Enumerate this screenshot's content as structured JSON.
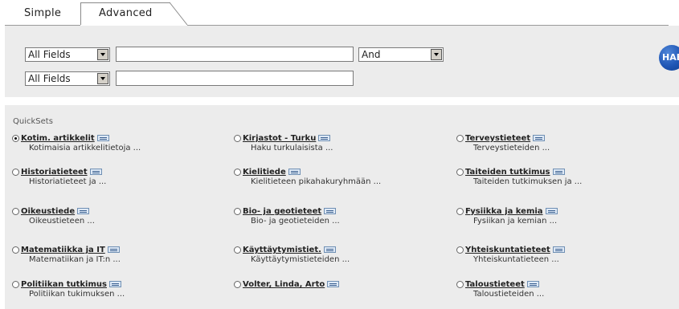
{
  "tabs": {
    "simple": "Simple",
    "advanced": "Advanced"
  },
  "search": {
    "row1": {
      "field": "All Fields",
      "value": "",
      "operator": "And"
    },
    "row2": {
      "field": "All Fields",
      "value": ""
    },
    "hab_label": "HAB"
  },
  "quicksets": {
    "title": "QuickSets",
    "items": [
      {
        "name": "Kotim. artikkelit",
        "desc": "Kotimaisia artikkelitietoja ...",
        "checked": true
      },
      {
        "name": "Kirjastot - Turku",
        "desc": "Haku turkulaisista ...",
        "checked": false
      },
      {
        "name": "Terveystieteet",
        "desc": "Terveystieteiden ...",
        "checked": false
      },
      {
        "name": "Historiatieteet",
        "desc": "Historiatieteet ja ...",
        "checked": false
      },
      {
        "name": "Kielitiede",
        "desc": "Kielitieteen pikahakuryhmään ...",
        "checked": false
      },
      {
        "name": "Taiteiden tutkimus",
        "desc": "Taiteiden tutkimuksen ja ...",
        "checked": false
      },
      {
        "name": "Oikeustiede",
        "desc": "Oikeustieteen ...",
        "checked": false
      },
      {
        "name": "Bio- ja geotieteet",
        "desc": "Bio- ja geotieteiden ...",
        "checked": false
      },
      {
        "name": "Fysiikka ja kemia",
        "desc": "Fysiikan ja kemian ...",
        "checked": false
      },
      {
        "name": "Matematiikka ja IT",
        "desc": "Matematiikan ja IT:n ...",
        "checked": false
      },
      {
        "name": "Käyttäytymistiet.",
        "desc": "Käyttäytymistieteiden ...",
        "checked": false
      },
      {
        "name": "Yhteiskuntatieteet",
        "desc": "Yhteiskuntatieteen ...",
        "checked": false
      },
      {
        "name": "Politiikan tutkimus",
        "desc": "Politiikan tukimuksen ...",
        "checked": false
      },
      {
        "name": "Volter, Linda, Arto",
        "desc": "",
        "checked": false
      },
      {
        "name": "Taloustieteet",
        "desc": "Taloustieteiden ...",
        "checked": false
      }
    ]
  }
}
